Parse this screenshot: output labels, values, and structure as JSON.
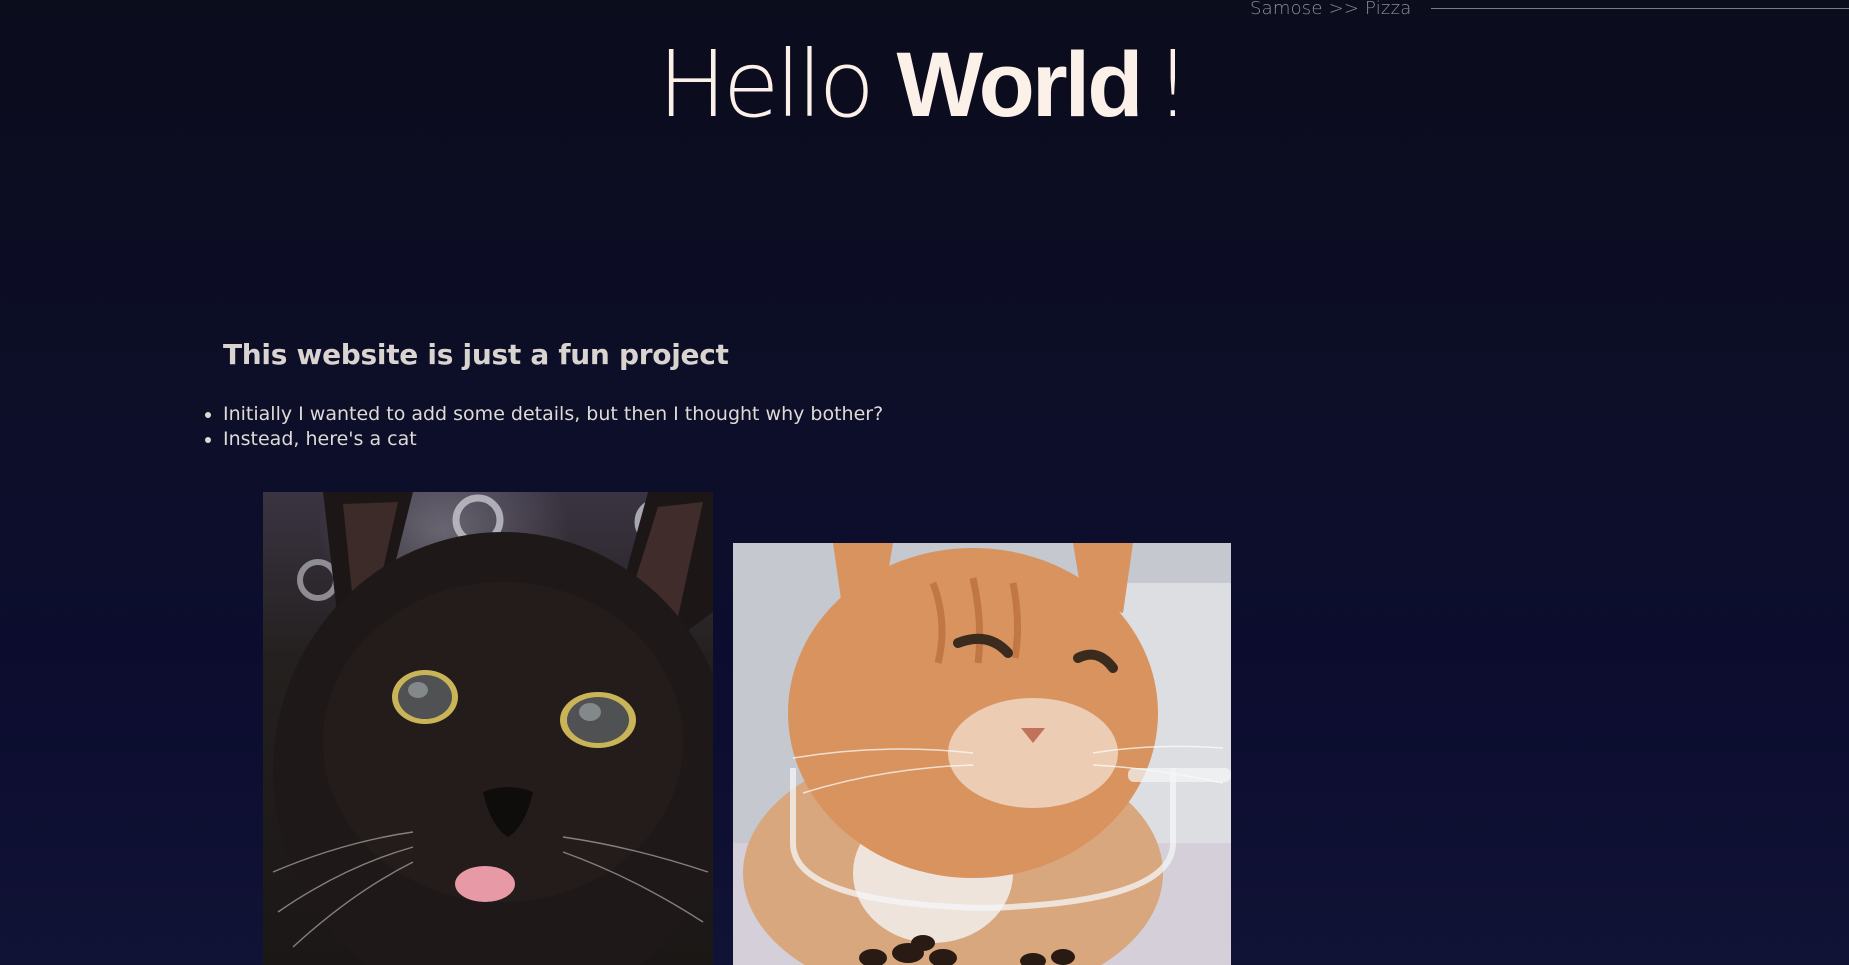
{
  "nav": {
    "breadcrumb": "Samose >> Pizza"
  },
  "hero": {
    "word1": "Hello",
    "word2": "World",
    "punct": "!"
  },
  "content": {
    "heading": "This website is just a fun project",
    "bullets": [
      "Initially I wanted to add some details, but then I thought why bother?",
      "Instead, here's a cat"
    ]
  },
  "images": {
    "black_cat": "black-cat-photo",
    "orange_cat": "orange-cat-photo"
  },
  "colors": {
    "background": "#0d0e29",
    "hero_text": "#fbf1e8",
    "nav_text": "#8e8ea2",
    "body_text": "#dedad6"
  }
}
